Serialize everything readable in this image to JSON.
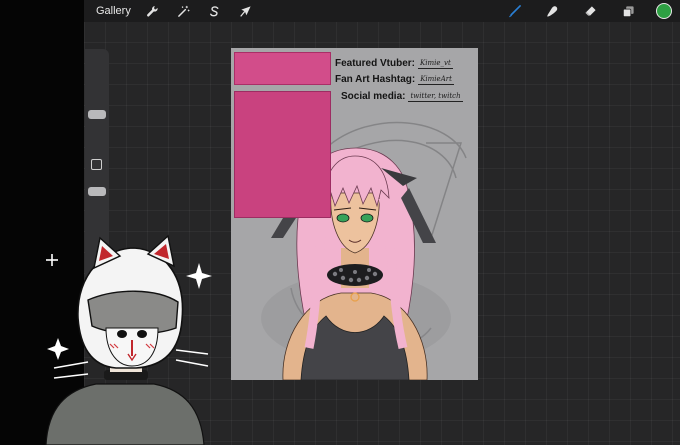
{
  "toolbar": {
    "gallery_label": "Gallery",
    "left_tools": [
      "wrench-icon",
      "magic-wand-icon",
      "selection-icon",
      "transform-arrow-icon"
    ],
    "right_tools": [
      "brush-icon",
      "smudge-icon",
      "eraser-icon",
      "layers-icon"
    ],
    "brush_color": "#2a7fd4",
    "current_color": "#2ea043"
  },
  "artwork": {
    "featured_label": "Featured Vtuber:",
    "featured_value": "Kimie_vt",
    "hashtag_label": "Fan Art Hashtag:",
    "hashtag_value": "KimieArt",
    "social_label": "Social media:",
    "social_value": "twitter, twitch"
  },
  "colors": {
    "canvas_bg": "#262627",
    "hair": "#f2b3cf",
    "reference_sheet": "#d24d8a",
    "eyes": "#37a35a"
  }
}
